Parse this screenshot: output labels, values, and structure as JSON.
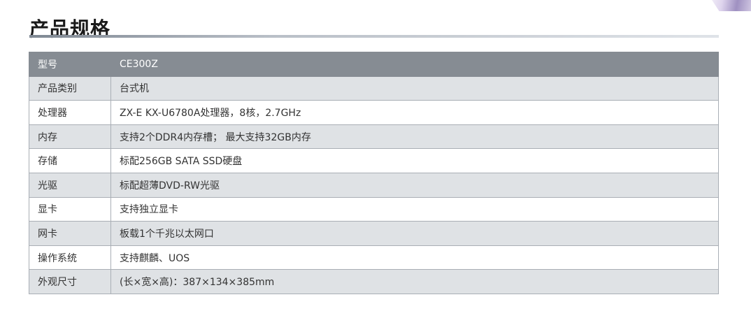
{
  "page": {
    "title": "产品规格"
  },
  "colors": {
    "header_bg": "#868c93",
    "header_text": "#ffffff",
    "alt_row_bg": "#dfe2e5",
    "row_bg": "#ffffff",
    "border": "#a9aeb5"
  },
  "spec_table": {
    "header": {
      "label": "型号",
      "value": "CE300Z"
    },
    "rows": [
      {
        "label": "产品类别",
        "value": "台式机"
      },
      {
        "label": "处理器",
        "value": "ZX-E KX-U6780A处理器，8核，2.7GHz"
      },
      {
        "label": "内存",
        "value": "支持2个DDR4内存槽； 最大支持32GB内存"
      },
      {
        "label": "存储",
        "value": "标配256GB SATA SSD硬盘"
      },
      {
        "label": "光驱",
        "value": "标配超薄DVD-RW光驱"
      },
      {
        "label": "显卡",
        "value": "支持独立显卡"
      },
      {
        "label": "网卡",
        "value": "板载1个千兆以太网口"
      },
      {
        "label": "操作系统",
        "value": "支持麒麟、UOS"
      },
      {
        "label": "外观尺寸",
        "value": "(长×宽×高)：387×134×385mm"
      }
    ]
  }
}
